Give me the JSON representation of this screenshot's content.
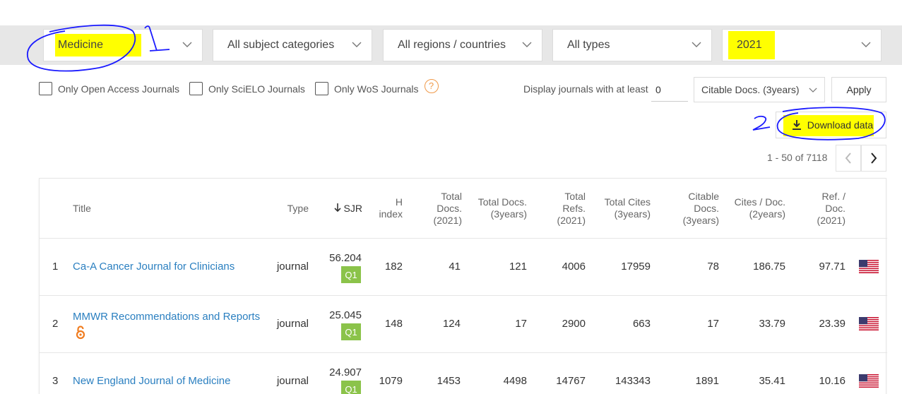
{
  "filters": {
    "subject_area": "Medicine",
    "subject_category": "All subject categories",
    "region": "All regions / countries",
    "type": "All types",
    "year": "2021"
  },
  "options": {
    "open_access": "Only Open Access Journals",
    "scielo": "Only SciELO Journals",
    "wos": "Only WoS Journals",
    "help_glyph": "?"
  },
  "display": {
    "label": "Display journals with at least",
    "min_value": "0",
    "metric": "Citable Docs. (3years)",
    "apply": "Apply"
  },
  "download": {
    "label": "Download data"
  },
  "pagination": {
    "range": "1 - 50 of 7118"
  },
  "table": {
    "headers": {
      "title": "Title",
      "type": "Type",
      "sjr": "SJR",
      "h_index": "H index",
      "total_docs": "Total Docs. (2021)",
      "total_docs_3y": "Total Docs. (3years)",
      "total_refs": "Total Refs. (2021)",
      "total_cites_3y": "Total Cites (3years)",
      "citable_docs_3y": "Citable Docs. (3years)",
      "cites_per_doc_2y": "Cites / Doc. (2years)",
      "ref_per_doc": "Ref. / Doc. (2021)"
    },
    "rows": [
      {
        "rank": "1",
        "title": "Ca-A Cancer Journal for Clinicians",
        "type": "journal",
        "sjr": "56.204",
        "quartile": "Q1",
        "h_index": "182",
        "total_docs": "41",
        "total_docs_3y": "121",
        "total_refs": "4006",
        "total_cites_3y": "17959",
        "citable_docs_3y": "78",
        "cites_per_doc": "186.75",
        "ref_per_doc": "97.71",
        "country": "United States",
        "open_access": false
      },
      {
        "rank": "2",
        "title": "MMWR Recommendations and Reports",
        "type": "journal",
        "sjr": "25.045",
        "quartile": "Q1",
        "h_index": "148",
        "total_docs": "124",
        "total_docs_3y": "17",
        "total_refs": "2900",
        "total_cites_3y": "663",
        "citable_docs_3y": "17",
        "cites_per_doc": "33.79",
        "ref_per_doc": "23.39",
        "country": "United States",
        "open_access": true
      },
      {
        "rank": "3",
        "title": "New England Journal of Medicine",
        "type": "journal",
        "sjr": "24.907",
        "quartile": "Q1",
        "h_index": "1079",
        "total_docs": "1453",
        "total_docs_3y": "4498",
        "total_refs": "14767",
        "total_cites_3y": "143343",
        "citable_docs_3y": "1891",
        "cites_per_doc": "35.41",
        "ref_per_doc": "10.16",
        "country": "United States",
        "open_access": false
      }
    ]
  },
  "annotations": {
    "mark_1": "1",
    "mark_2": "2"
  },
  "colors": {
    "highlight": "#ffff00",
    "ink": "#1a1aff",
    "link": "#2a7fc0",
    "quartile_q1": "#8bc34a",
    "open_access": "#f07c1f"
  }
}
